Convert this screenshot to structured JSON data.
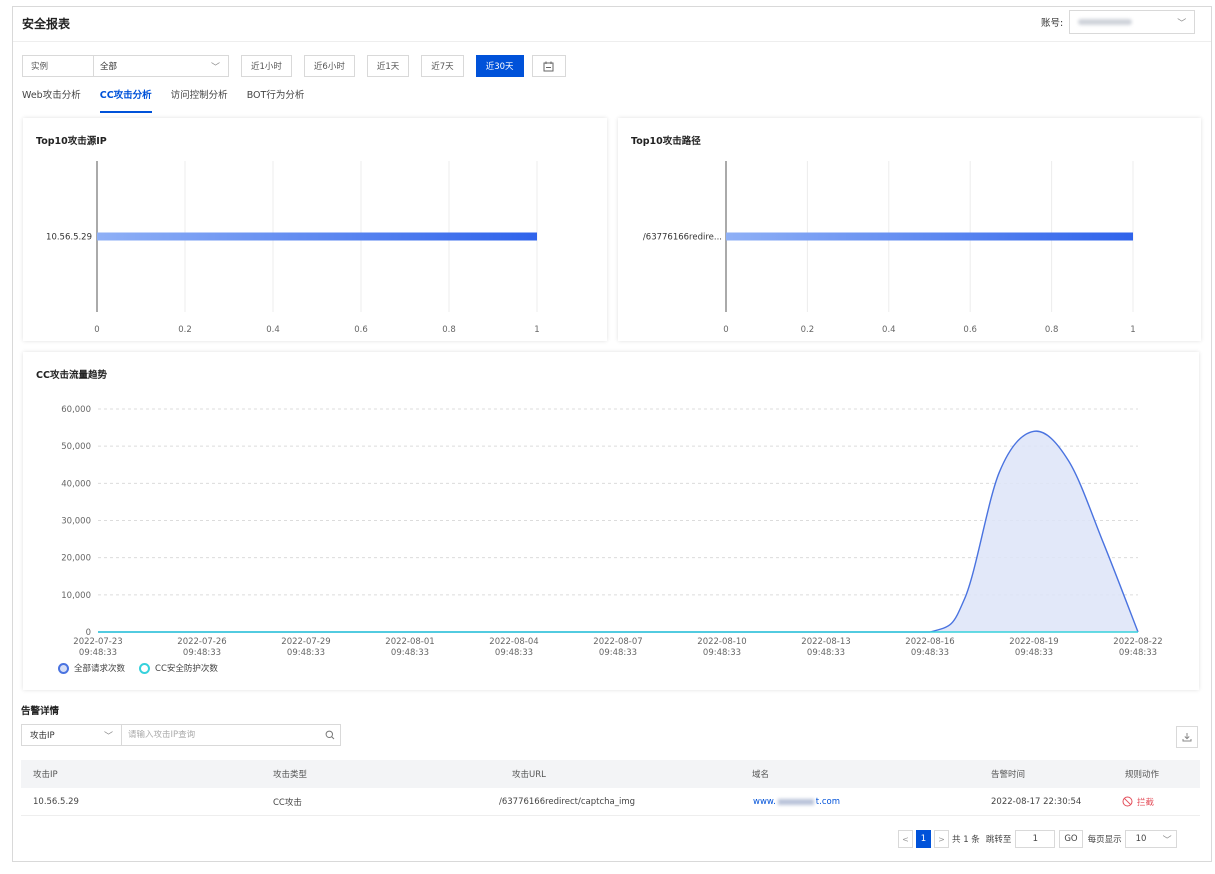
{
  "header": {
    "title": "安全报表",
    "account_label": "账号:"
  },
  "filter": {
    "instance_label": "实例",
    "instance_value": "全部",
    "time_buttons": [
      "近1小时",
      "近6小时",
      "近1天",
      "近7天",
      "近30天"
    ],
    "active_time": "近30天"
  },
  "tabs": [
    "Web攻击分析",
    "CC攻击分析",
    "访问控制分析",
    "BOT行为分析"
  ],
  "active_tab": "CC攻击分析",
  "top_ip": {
    "title": "Top10攻击源IP"
  },
  "top_path": {
    "title": "Top10攻击路径"
  },
  "trend": {
    "title": "CC攻击流量趋势",
    "legend": [
      "全部请求次数",
      "CC安全防护次数"
    ]
  },
  "colors": {
    "primary": "#0052d9",
    "series_all": "#4a73e0",
    "series_cc": "#36d1dc",
    "danger": "#e34d59"
  },
  "chart_data": [
    {
      "type": "bar",
      "orientation": "horizontal",
      "title": "Top10攻击源IP",
      "categories": [
        "10.56.5.29"
      ],
      "values": [
        1
      ],
      "xlim": [
        0,
        1
      ],
      "xticks": [
        "0",
        "0.2",
        "0.4",
        "0.6",
        "0.8",
        "1"
      ],
      "grid": true
    },
    {
      "type": "bar",
      "orientation": "horizontal",
      "title": "Top10攻击路径",
      "categories": [
        "/63776166redire..."
      ],
      "values": [
        1
      ],
      "xlim": [
        0,
        1
      ],
      "xticks": [
        "0",
        "0.2",
        "0.4",
        "0.6",
        "0.8",
        "1"
      ],
      "grid": true
    },
    {
      "type": "area",
      "title": "CC攻击流量趋势",
      "x": [
        "2022-07-23 09:48:33",
        "2022-07-26 09:48:33",
        "2022-07-29 09:48:33",
        "2022-08-01 09:48:33",
        "2022-08-04 09:48:33",
        "2022-08-07 09:48:33",
        "2022-08-10 09:48:33",
        "2022-08-13 09:48:33",
        "2022-08-16 09:48:33",
        "2022-08-17 09:48:33",
        "2022-08-18 09:48:33",
        "2022-08-19 09:48:33",
        "2022-08-20 09:48:33",
        "2022-08-21 09:48:33",
        "2022-08-22 09:48:33"
      ],
      "xticks": [
        "2022-07-23 09:48:33",
        "2022-07-26 09:48:33",
        "2022-07-29 09:48:33",
        "2022-08-01 09:48:33",
        "2022-08-04 09:48:33",
        "2022-08-07 09:48:33",
        "2022-08-10 09:48:33",
        "2022-08-13 09:48:33",
        "2022-08-16 09:48:33",
        "2022-08-19 09:48:33",
        "2022-08-22 09:48:33"
      ],
      "series": [
        {
          "name": "全部请求次数",
          "values": [
            0,
            0,
            0,
            0,
            0,
            0,
            0,
            0,
            0,
            9000,
            43000,
            54000,
            46000,
            24000,
            0
          ]
        },
        {
          "name": "CC安全防护次数",
          "values": [
            0,
            0,
            0,
            0,
            0,
            0,
            0,
            0,
            0,
            0,
            0,
            0,
            0,
            0,
            0
          ]
        }
      ],
      "ylim": [
        0,
        60000
      ],
      "yticks": [
        "0",
        "10,000",
        "20,000",
        "30,000",
        "40,000",
        "50,000",
        "60,000"
      ],
      "grid": true
    }
  ],
  "alerts": {
    "title": "告警详情",
    "search_type": "攻击IP",
    "search_placeholder": "请输入攻击IP查询",
    "columns": [
      "攻击IP",
      "攻击类型",
      "攻击URL",
      "域名",
      "告警时间",
      "规则动作"
    ],
    "rows": [
      {
        "ip": "10.56.5.29",
        "type": "CC攻击",
        "url": "/63776166redirect/captcha_img",
        "domain_prefix": "www.",
        "domain_suffix": "t.com",
        "time": "2022-08-17 22:30:54",
        "action": "拦截"
      }
    ]
  },
  "pager": {
    "current": "1",
    "total": "共 1 条",
    "jump_label": "跳转至",
    "jump_value": "1",
    "go": "GO",
    "per_page_label": "每页显示",
    "per_page": "10"
  }
}
